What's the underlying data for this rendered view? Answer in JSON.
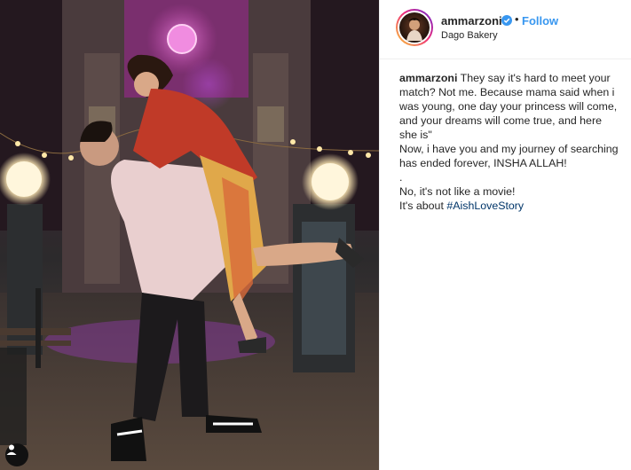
{
  "post": {
    "username": "ammarzoni",
    "follow_label": "Follow",
    "separator": "•",
    "location": "Dago Bakery",
    "caption": {
      "username": "ammarzoni",
      "line1": "They say it's hard to meet your match? Not me. Because mama said when i was young, one day your princess will come, and your dreams will come true, and here she is\"",
      "line2": "Now, i have you and my journey of searching has ended forever, INSHA ALLAH!",
      "line3": ".",
      "line4": "No, it's not like a movie!",
      "line5_prefix": "It's about ",
      "hashtag": "#AishLoveStory"
    }
  },
  "colors": {
    "accent": "#3897f0",
    "hashtag": "#003569",
    "verified": "#3897f0",
    "lamp_light": "#fff3d6",
    "clock_glow": "#e06bd0"
  },
  "icons": {
    "verified": "verified-badge-icon",
    "tag": "user-tag-icon"
  }
}
